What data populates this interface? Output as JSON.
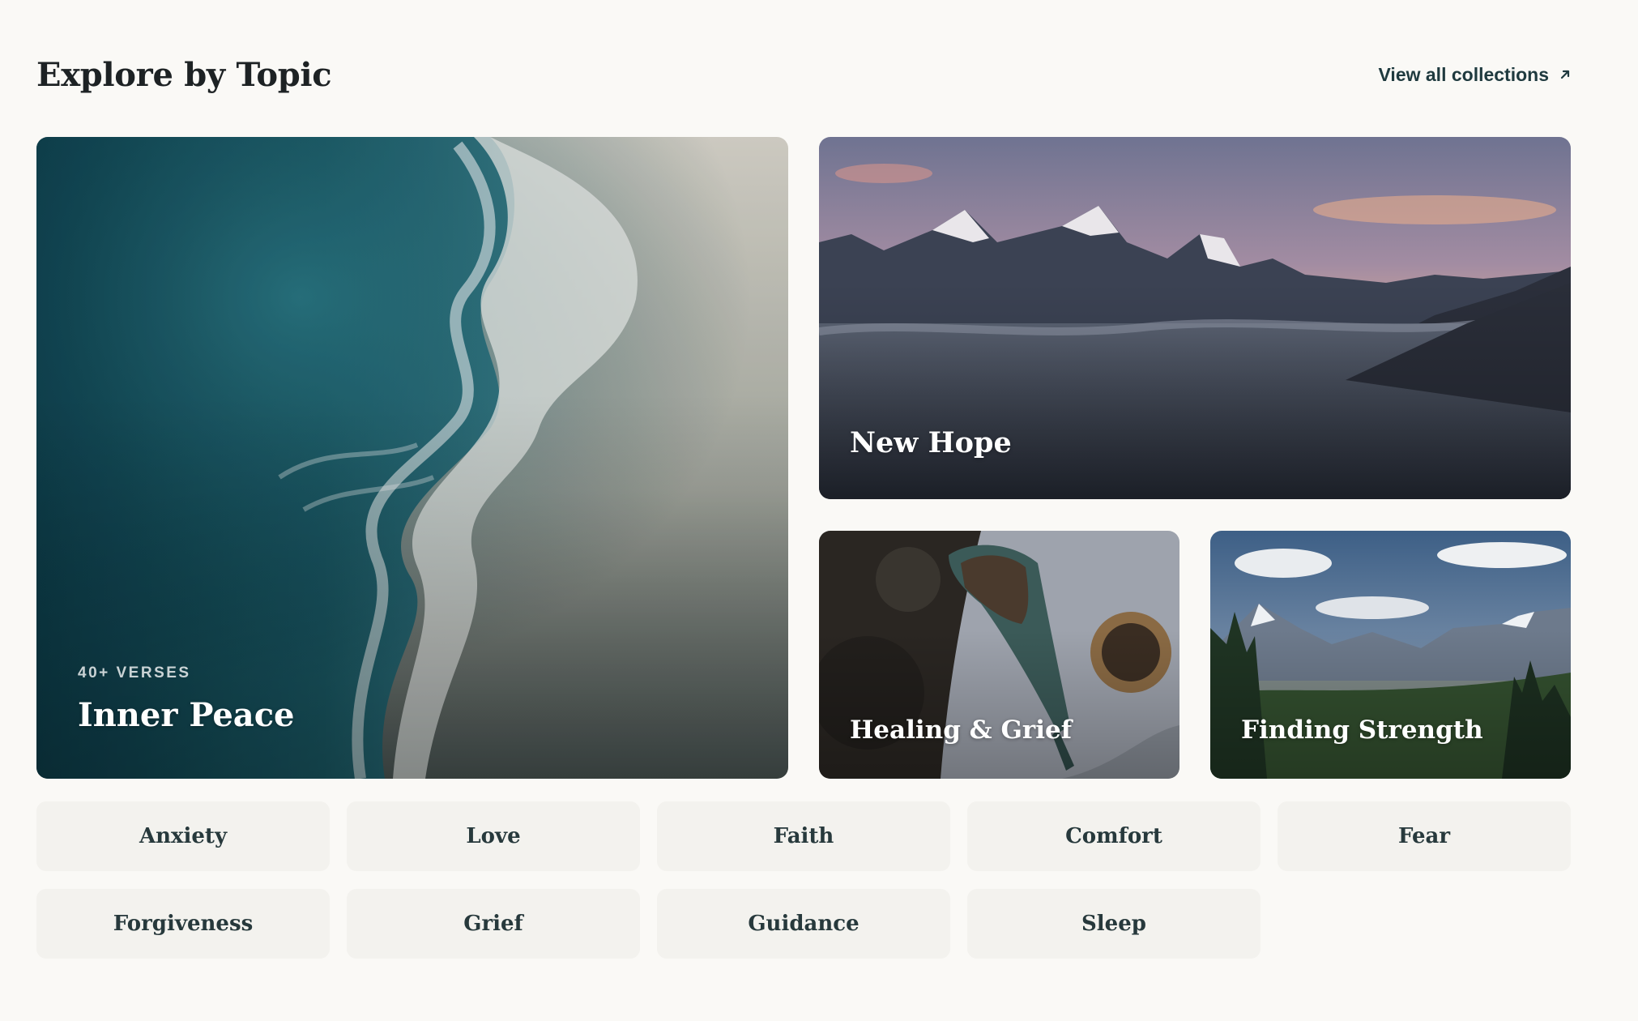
{
  "header": {
    "title": "Explore by Topic",
    "view_all_label": "View all collections",
    "view_all_icon": "arrow-up-right-icon"
  },
  "featured": {
    "inner_peace": {
      "eyebrow": "40+ VERSES",
      "title": "Inner Peace",
      "image": "aerial-ocean-shore"
    },
    "new_hope": {
      "title": "New Hope",
      "image": "mountain-sunrise-clouds"
    },
    "healing": {
      "title": "Healing & Grief",
      "image": "garden-trowel-soil"
    },
    "strength": {
      "title": "Finding Strength",
      "image": "mountain-valley-forest"
    }
  },
  "topics": [
    "Anxiety",
    "Love",
    "Faith",
    "Comfort",
    "Fear",
    "Forgiveness",
    "Grief",
    "Guidance",
    "Sleep"
  ],
  "colors": {
    "background": "#faf9f6",
    "chip": "#f3f2ee",
    "chip_text": "#27393c",
    "link": "#1f3a3f"
  }
}
